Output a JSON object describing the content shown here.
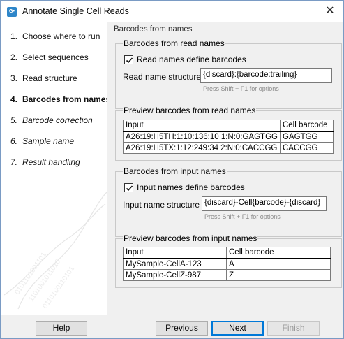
{
  "window": {
    "title": "Annotate Single Cell Reads",
    "icon_text": "G•",
    "close_glyph": "✕"
  },
  "steps": [
    {
      "num": "1.",
      "label": "Choose where to run",
      "state": "done"
    },
    {
      "num": "2.",
      "label": "Select sequences",
      "state": "done"
    },
    {
      "num": "3.",
      "label": "Read structure",
      "state": "done"
    },
    {
      "num": "4.",
      "label": "Barcodes from names",
      "state": "current"
    },
    {
      "num": "5.",
      "label": "Barcode correction",
      "state": "future"
    },
    {
      "num": "6.",
      "label": "Sample name",
      "state": "future"
    },
    {
      "num": "7.",
      "label": "Result handling",
      "state": "future"
    }
  ],
  "page": {
    "heading": "Barcodes from names"
  },
  "read_names": {
    "group_title": "Barcodes from read names",
    "checkbox_label": "Read names define barcodes",
    "checked": true,
    "structure_label": "Read name structure",
    "structure_value": "{discard}:{barcode:trailing}",
    "hint": "Press Shift + F1 for options"
  },
  "read_preview": {
    "group_title": "Preview barcodes from read names",
    "headers": [
      "Input",
      "Cell barcode"
    ],
    "rows": [
      [
        "A26:19:H5TH:1:10:136:10 1:N:0:GAGTGG",
        "GAGTGG"
      ],
      [
        "A26:19:H5TX:1:12:249:34 2:N:0:CACCGG",
        "CACCGG"
      ]
    ]
  },
  "input_names": {
    "group_title": "Barcodes from input names",
    "checkbox_label": "Input names define barcodes",
    "checked": true,
    "structure_label": "Input name structure",
    "structure_value": "{discard}-Cell{barcode}-{discard}",
    "hint": "Press Shift + F1 for options"
  },
  "input_preview": {
    "group_title": "Preview barcodes from input names",
    "headers": [
      "Input",
      "Cell barcode"
    ],
    "rows": [
      [
        "MySample-CellA-123",
        "A"
      ],
      [
        "MySample-CellZ-987",
        "Z"
      ]
    ]
  },
  "buttons": {
    "help": "Help",
    "previous": "Previous",
    "next": "Next",
    "finish": "Finish"
  },
  "colors": {
    "accent": "#0078d7",
    "icon": "#2e86c9"
  }
}
